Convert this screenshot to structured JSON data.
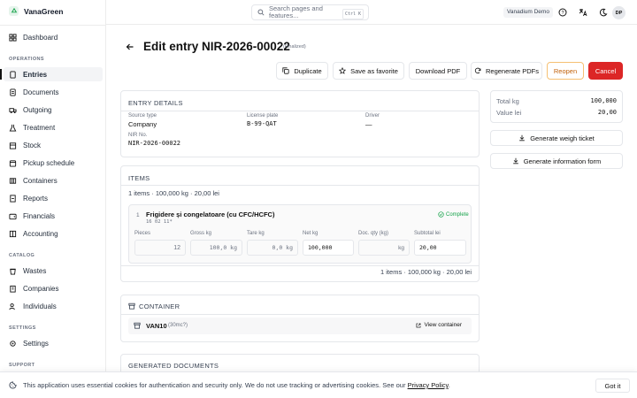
{
  "app": {
    "name": "VanaGreen"
  },
  "nav": {
    "dashboard": "Dashboard",
    "operations_label": "OPERATIONS",
    "entries": "Entries",
    "documents": "Documents",
    "outgoing": "Outgoing",
    "treatment": "Treatment",
    "stock": "Stock",
    "pickup": "Pickup schedule",
    "containers": "Containers",
    "reports": "Reports",
    "financials": "Financials",
    "accounting": "Accounting",
    "catalog_label": "CATALOG",
    "wastes": "Wastes",
    "companies": "Companies",
    "individuals": "Individuals",
    "settings_label": "SETTINGS",
    "settings": "Settings",
    "support_label": "SUPPORT"
  },
  "topbar": {
    "search_line1": "Search pages and",
    "search_line2": "features...",
    "shortcut": "Ctrl K",
    "tenant": "Vanadium Demo",
    "avatar": "DP"
  },
  "page": {
    "title": "Edit entry NIR-2026-00022",
    "status": "(Finalized)"
  },
  "actions": {
    "duplicate": "Duplicate",
    "save_favorite": "Save as favorite",
    "download_pdf": "Download PDF",
    "regenerate": "Regenerate PDFs",
    "reopen": "Reopen",
    "cancel": "Cancel"
  },
  "entry_details": {
    "title": "ENTRY DETAILS",
    "source_type_label": "Source type",
    "source_type": "Company",
    "plate_label": "License plate",
    "plate": "B-99-QAT",
    "driver_label": "Driver",
    "driver": "—",
    "nir_label": "NIR No.",
    "nir": "NIR-2026-00022"
  },
  "items": {
    "title": "ITEMS",
    "summary": "1 items · 100,000 kg · 20,00 lei",
    "item": {
      "index": "1",
      "name": "Frigidere și congelatoare (cu CFC/HCFC)",
      "code": "16 02 11*",
      "status": "Complete",
      "pieces_label": "Pieces",
      "pieces": "12",
      "gross_label": "Gross kg",
      "gross": "100,0 kg",
      "tare_label": "Tare kg",
      "tare": "0,0 kg",
      "net_label": "Net kg",
      "net": "100,000",
      "docqty_label": "Doc. qty (kg)",
      "docqty": "kg",
      "subtotal_label": "Subtotal lei",
      "subtotal": "20,00"
    },
    "footer": "1 items · 100,000 kg · 20,00 lei"
  },
  "container": {
    "title": "CONTAINER",
    "name": "VAN10",
    "volume": "(30mc?)",
    "view": "View container"
  },
  "generated_docs": {
    "title": "GENERATED DOCUMENTS"
  },
  "totals": {
    "total_kg_label": "Total kg",
    "total_kg": "100,000",
    "value_label": "Value lei",
    "value": "20,00"
  },
  "side_actions": {
    "weigh_ticket": "Generate weigh ticket",
    "info_form": "Generate information form"
  },
  "cookie": {
    "text": "This application uses essential cookies for authentication and security only. We do not use tracking or advertising cookies. See our",
    "link": "Privacy Policy",
    "period": ".",
    "button": "Got it"
  },
  "colors": {
    "brand": "#16a34a",
    "danger": "#dc2626",
    "warning": "#c2610a"
  }
}
